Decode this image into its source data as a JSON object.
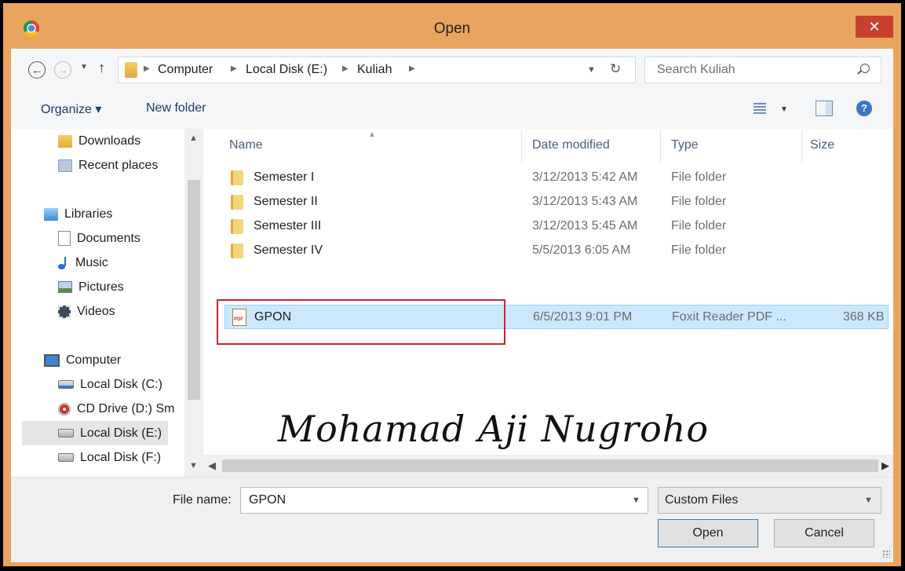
{
  "window": {
    "title": "Open",
    "close_label": "✕"
  },
  "address": {
    "crumbs": [
      "Computer",
      "Local Disk (E:)",
      "Kuliah"
    ],
    "search_placeholder": "Search Kuliah"
  },
  "toolbar": {
    "organize_label": "Organize ▾",
    "new_folder_label": "New folder"
  },
  "nav_pane": {
    "items": [
      {
        "label": "Downloads",
        "icon": "downloads-icon"
      },
      {
        "label": "Recent places",
        "icon": "recent-places-icon"
      },
      {
        "label": "Libraries",
        "icon": "libraries-icon"
      },
      {
        "label": "Documents",
        "icon": "documents-icon"
      },
      {
        "label": "Music",
        "icon": "music-icon"
      },
      {
        "label": "Pictures",
        "icon": "pictures-icon"
      },
      {
        "label": "Videos",
        "icon": "videos-icon"
      },
      {
        "label": "Computer",
        "icon": "computer-icon"
      },
      {
        "label": "Local Disk (C:)",
        "icon": "local-disk-icon"
      },
      {
        "label": "CD Drive (D:) Sm",
        "icon": "cd-drive-icon"
      },
      {
        "label": "Local Disk (E:)",
        "icon": "local-disk-icon",
        "selected": true
      },
      {
        "label": "Local Disk (F:)",
        "icon": "local-disk-icon"
      }
    ]
  },
  "file_list": {
    "columns": [
      "Name",
      "Date modified",
      "Type",
      "Size"
    ],
    "rows": [
      {
        "name": "Semester I",
        "date": "3/12/2013 5:42 AM",
        "type": "File folder",
        "size": "",
        "icon": "folder-icon"
      },
      {
        "name": "Semester II",
        "date": "3/12/2013 5:43 AM",
        "type": "File folder",
        "size": "",
        "icon": "folder-icon"
      },
      {
        "name": "Semester III",
        "date": "3/12/2013 5:45 AM",
        "type": "File folder",
        "size": "",
        "icon": "folder-icon"
      },
      {
        "name": "Semester IV",
        "date": "5/5/2013 6:05 AM",
        "type": "File folder",
        "size": "",
        "icon": "folder-icon"
      },
      {
        "name": "GPON",
        "date": "6/5/2013 9:01 PM",
        "type": "Foxit Reader PDF ...",
        "size": "368 KB",
        "icon": "pdf-file-icon",
        "selected": true
      }
    ]
  },
  "watermark": "Mohamad Aji Nugroho",
  "bottom": {
    "file_name_label": "File name:",
    "file_name_value": "GPON",
    "file_type_value": "Custom Files",
    "open_label": "Open",
    "cancel_label": "Cancel"
  },
  "colors": {
    "frame": "#e9a460",
    "close_button": "#c7412f",
    "selection": "#cce8ff",
    "highlight_box": "#c8232c"
  }
}
